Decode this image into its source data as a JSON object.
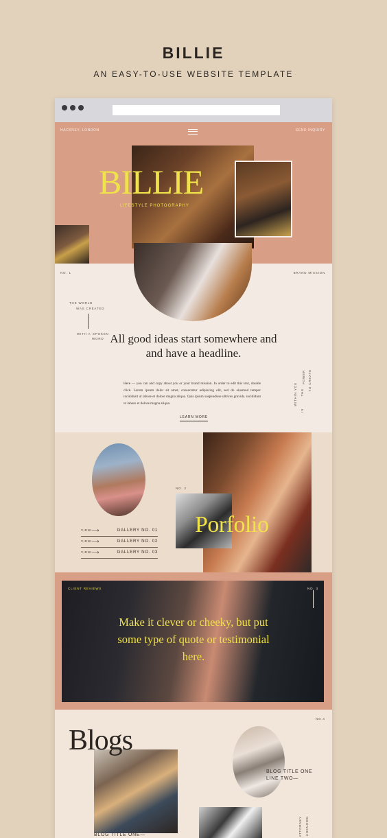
{
  "header": {
    "title": "BILLIE",
    "subtitle": "AN EASY-TO-USE WEBSITE TEMPLATE"
  },
  "nav": {
    "location": "HACKNEY, LONDON",
    "inquiry": "SEND INQUIRY"
  },
  "hero": {
    "name": "BILLIE",
    "tagline": "LIFESTYLE PHOTOGRAPHY"
  },
  "mission": {
    "number": "NO. 1",
    "label": "BRAND MISSION",
    "side_text": [
      "THE WORLD",
      "WAS CREATED",
      "WITH A",
      "SPOKEN",
      "WORD"
    ],
    "headline": "All good ideas start somewhere and and have a headline.",
    "body": "Here — you can add copy about you or your brand mission. In order to edit this text, double click. Lorem ipsum dolor sit amet, consectetur adipiscing elit, sed do eiusmod tempor incididunt ut labore et dolore magna aliqua. Quis ipsum suspendisse ultrices gravida. incididunt ut labore et dolore magna aliqua.",
    "link": "LEARN MORE",
    "vertical_text": [
      "WITHIN YOU",
      "IS",
      "THE",
      "POWER",
      "TO CREATE"
    ]
  },
  "portfolio": {
    "number": "NO. 2",
    "title": "Porfolio",
    "galleries": [
      {
        "view": "VIEW",
        "label": "GALLERY NO. 01"
      },
      {
        "view": "VIEW",
        "label": "GALLERY NO. 02"
      },
      {
        "view": "VIEW",
        "label": "GALLERY NO. 03"
      }
    ]
  },
  "reviews": {
    "label": "CLIENT REVIEWS",
    "number": "NO. 3",
    "quote": "Make it clever or cheeky, but put some type of quote or testimonial here."
  },
  "blogs": {
    "number": "NO.4",
    "title": "Blogs",
    "post_1": "BLOG TITLE ONE—",
    "post_2_line1": "BLOG TITLE ONE",
    "post_2_line2": "LINE TWO—",
    "vertical_1": "ATTORNEY",
    "vertical_2": "UNKNOWN"
  },
  "colors": {
    "background": "#e2d2bc",
    "terracotta": "#d99e86",
    "cream": "#f3ebe3",
    "accent_yellow": "#f0e24a",
    "ink": "#2b2521"
  }
}
